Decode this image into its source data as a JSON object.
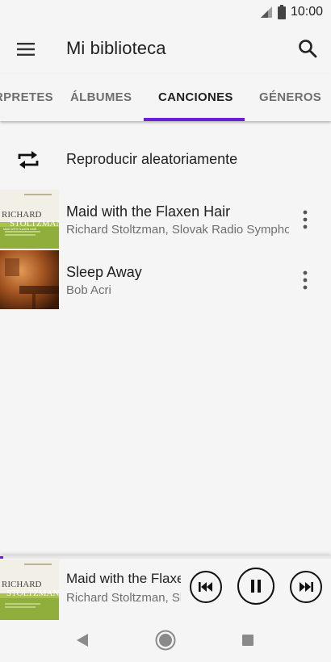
{
  "status_bar": {
    "time": "10:00",
    "icons": [
      "signal-icon",
      "battery-icon"
    ]
  },
  "header": {
    "title": "Mi biblioteca",
    "menu_icon": "menu-icon",
    "search_icon": "search-icon"
  },
  "tabs": [
    {
      "label": "RPRETES",
      "active": false
    },
    {
      "label": "ÁLBUMES",
      "active": false
    },
    {
      "label": "CANCIONES",
      "active": true
    },
    {
      "label": "GÉNEROS",
      "active": false
    }
  ],
  "shuffle": {
    "label": "Reproducir aleatoriamente",
    "icon": "shuffle-icon"
  },
  "songs": [
    {
      "title": "Maid with the Flaxen Hair",
      "artist": "Richard Stoltzman, Slovak Radio Symphony Orchestra",
      "art_text_1": "RICHARD",
      "art_text_2": "STOLTZMAN",
      "art_text_3": "MAID WITH FLAXEN HAIR"
    },
    {
      "title": "Sleep Away",
      "artist": "Bob Acri"
    }
  ],
  "player": {
    "title": "Maid with the Flaxen Hair",
    "artist": "Richard Stoltzman, Slovak Radio Symphony Orchestra",
    "progress": 0.01,
    "controls": [
      "skip-previous-icon",
      "pause-icon",
      "skip-next-icon"
    ]
  },
  "colors": {
    "accent": "#6a1fd6",
    "background": "#f5f5f5",
    "text_primary": "#212121",
    "text_secondary": "#6f6f6f"
  }
}
